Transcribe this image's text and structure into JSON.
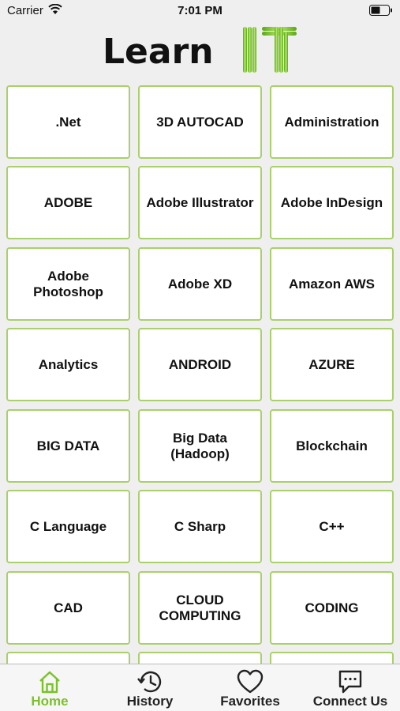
{
  "status_bar": {
    "carrier": "Carrier",
    "time": "7:01 PM"
  },
  "header": {
    "logo_text": "Learn IT",
    "logo_color": "#7cc12a"
  },
  "tiles": [
    ".Net",
    "3D AUTOCAD",
    "Administration",
    "ADOBE",
    "Adobe Illustrator",
    "Adobe InDesign",
    "Adobe Photoshop",
    "Adobe XD",
    "Amazon AWS",
    "Analytics",
    "ANDROID",
    "AZURE",
    "BIG DATA",
    "Big Data\n(Hadoop)",
    "Blockchain",
    "C Language",
    "C Sharp",
    "C++",
    "CAD",
    "CLOUD\nCOMPUTING",
    "CODING",
    "",
    "",
    ""
  ],
  "tab_bar": {
    "items": [
      {
        "label": "Home",
        "icon": "home-icon",
        "active": true
      },
      {
        "label": "History",
        "icon": "history-icon",
        "active": false
      },
      {
        "label": "Favorites",
        "icon": "heart-icon",
        "active": false
      },
      {
        "label": "Connect Us",
        "icon": "chat-icon",
        "active": false
      }
    ]
  },
  "colors": {
    "accent": "#7cc12a",
    "tile_border": "#a9d06b",
    "background": "#efefef"
  }
}
